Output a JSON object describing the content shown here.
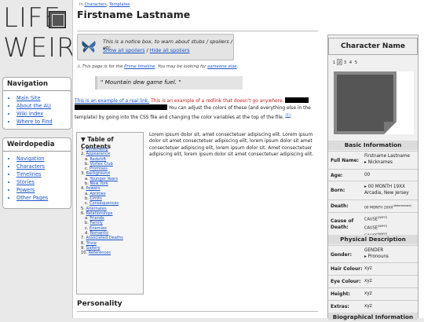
{
  "logo": {
    "line1": "LIFE",
    "line2": "WEIRD"
  },
  "sidebar": {
    "nav_title": "Navigation",
    "nav_items": [
      "Main Site",
      "About the AU",
      "Wiki Index",
      "Where to Find"
    ],
    "weird_title": "Weirdopedia",
    "weird_items": [
      "Navigation",
      "Characters",
      "Timelines",
      "Stories",
      "Powers",
      "Other Pages"
    ]
  },
  "breadcrumb": {
    "prefix": "In",
    "cat1": "Characters",
    "sep": ",",
    "cat2": "Templates"
  },
  "page": {
    "title": "Firstname Lastname"
  },
  "notice": {
    "text": "This is a notice box, to warn about stubs / spoilers / etc.",
    "link1": "Show all spoilers",
    "sep": "/",
    "link2": "Hide all spoilers"
  },
  "hatnote": {
    "prefix": "This page is for the",
    "link1": "Prime timeline",
    "middle": ". You may be looking for",
    "link2": "someone else",
    "end": "."
  },
  "quote": "\" Mountain dew game fuel. \"",
  "para1": {
    "link": "This is an example of a real link.",
    "redlink": "This is an example of a redlink that doesn't go anywhere.",
    "rest": "You can adjust the colors of these (and everything else in the template) by going into the CSS file and changing the color variables at the top of the file.",
    "ref": "[1]"
  },
  "toc": {
    "title": "Table of Contents",
    "items": [
      {
        "n": "1.",
        "t": "Personality",
        "sub": false
      },
      {
        "n": "2.",
        "t": "Appearance",
        "sub": false
      },
      {
        "n": "a.",
        "t": "Redshift",
        "sub": true
      },
      {
        "n": "b.",
        "t": "Vortex Club",
        "sub": true
      },
      {
        "n": "c.",
        "t": "Promises",
        "sub": true
      },
      {
        "n": "3.",
        "t": "Background",
        "sub": false
      },
      {
        "n": "a.",
        "t": "Younger Years",
        "sub": true
      },
      {
        "n": "b.",
        "t": "New York",
        "sub": true
      },
      {
        "n": "4.",
        "t": "Powers",
        "sub": false
      },
      {
        "n": "a.",
        "t": "Abilities",
        "sub": true
      },
      {
        "n": "b.",
        "t": "Limits",
        "sub": true
      },
      {
        "n": "c.",
        "t": "Consequences",
        "sub": true
      },
      {
        "n": "5.",
        "t": "Alternates",
        "sub": false
      },
      {
        "n": "6.",
        "t": "Relationships",
        "sub": false
      },
      {
        "n": "a.",
        "t": "Friends",
        "sub": true
      },
      {
        "n": "b.",
        "t": "Family",
        "sub": true
      },
      {
        "n": "c.",
        "t": "Enemies",
        "sub": true
      },
      {
        "n": "d.",
        "t": "Romantic",
        "sub": true
      },
      {
        "n": "7.",
        "t": "Associated Deaths",
        "sub": false
      },
      {
        "n": "8.",
        "t": "Trivia",
        "sub": false
      },
      {
        "n": "9.",
        "t": "Gallery",
        "sub": false
      },
      {
        "n": "10.",
        "t": "References",
        "sub": false
      }
    ]
  },
  "lorem": "Lorem ipsum dolor sit, amet consectetuer adipiscing elit. Lorem ipsum dolor sit amet consectetuer adipiscing elit; lorem ipsum dolor sit amet consectetuer adipiscing elit, lorem ipsum dolor sit. Amet consectetuer adipiscing elit, lorem ipsum dolor sit amet consectetuer adipiscing elit.",
  "section_heading": "Personality",
  "infobox": {
    "title": "Character Name",
    "tabs": [
      "1",
      "2",
      "3",
      "4",
      "5"
    ],
    "active_tab": "2",
    "basic_title": "Basic Information",
    "full_name_k": "Full Name:",
    "full_name_v1": "Firstname Lastname",
    "full_name_v2": "▸ Nicknames",
    "age_k": "Age:",
    "age_v": "00",
    "born_k": "Born:",
    "born_v1": "▸ 00 MONTH 19XX",
    "born_v2": "Arcadia, New Jersey",
    "death_k": "Death:",
    "death_v": "00 MONTH 20XX",
    "death_sup": "(determinant)",
    "cause_k1": "Cause of",
    "cause_k2": "Death:",
    "cause_v": "CAUSE",
    "cause_sup": "(WHY?)",
    "physical_title": "Physical Description",
    "gender_k": "Gender:",
    "gender_v1": "GENDER",
    "gender_v2": "▸ Pronouns",
    "hair_k": "Hair Colour:",
    "hair_v": "xyz",
    "eye_k": "Eye Colour:",
    "eye_v": "xyz",
    "height_k": "Height:",
    "height_v": "xyz",
    "extras_k": "Extras:",
    "extras_v": "xyz",
    "bio_title": "Biographical Information"
  }
}
